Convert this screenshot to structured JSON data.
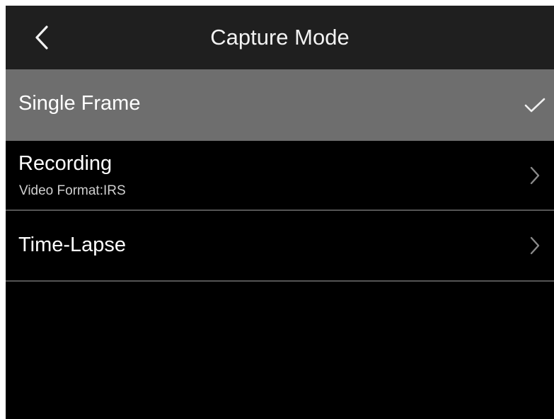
{
  "app": {
    "title": "Capture Mode"
  },
  "header": {
    "back_icon": "chevron-left-icon"
  },
  "modes": [
    {
      "label": "Single Frame",
      "sublabel": "",
      "selected": true,
      "trailing_icon": "checkmark-icon"
    },
    {
      "label": "Recording",
      "sublabel": "Video Format:IRS",
      "selected": false,
      "trailing_icon": "chevron-right-icon"
    },
    {
      "label": "Time-Lapse",
      "sublabel": "",
      "selected": false,
      "trailing_icon": "chevron-right-icon"
    }
  ],
  "colors": {
    "header_background": "#1f1f1f",
    "screen_background": "#000000",
    "selected_row_background": "#6e6e6e",
    "divider": "#555555",
    "text": "#ffffff",
    "secondary_text": "#cfcfcf"
  }
}
